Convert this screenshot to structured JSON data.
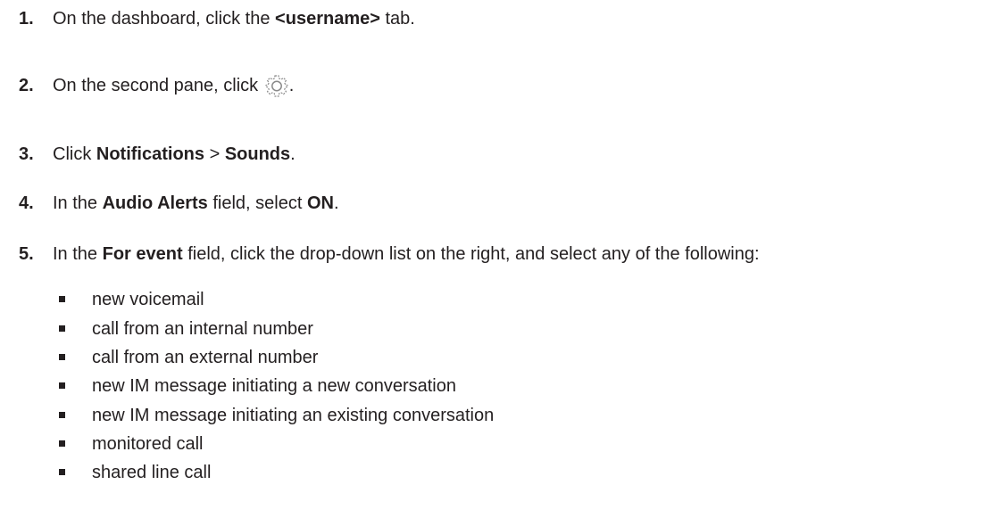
{
  "steps": [
    {
      "num": "1.",
      "pre": "On the dashboard, click the ",
      "bold": "<username>",
      "post": " tab."
    },
    {
      "num": "2.",
      "pre": "On the second pane, click ",
      "icon": "gear-icon",
      "post": "."
    },
    {
      "num": "3.",
      "pre": "Click ",
      "bold1": "Notifications",
      "mid": " > ",
      "bold2": "Sounds",
      "post": "."
    },
    {
      "num": "4.",
      "pre": "In the ",
      "bold1": "Audio Alerts",
      "mid": " field, select ",
      "bold2": "ON",
      "post": "."
    },
    {
      "num": "5.",
      "pre": "In the ",
      "bold": "For event",
      "post": " field, click the drop-down list on the right, and select any of the following:"
    }
  ],
  "events": [
    "new voicemail",
    "call from an internal number",
    "call from an external number",
    "new IM message initiating a new conversation",
    "new IM message initiating an existing conversation",
    "monitored call",
    "shared line call"
  ],
  "colors": {
    "text": "#231f20",
    "icon": "#8a8a8a"
  }
}
